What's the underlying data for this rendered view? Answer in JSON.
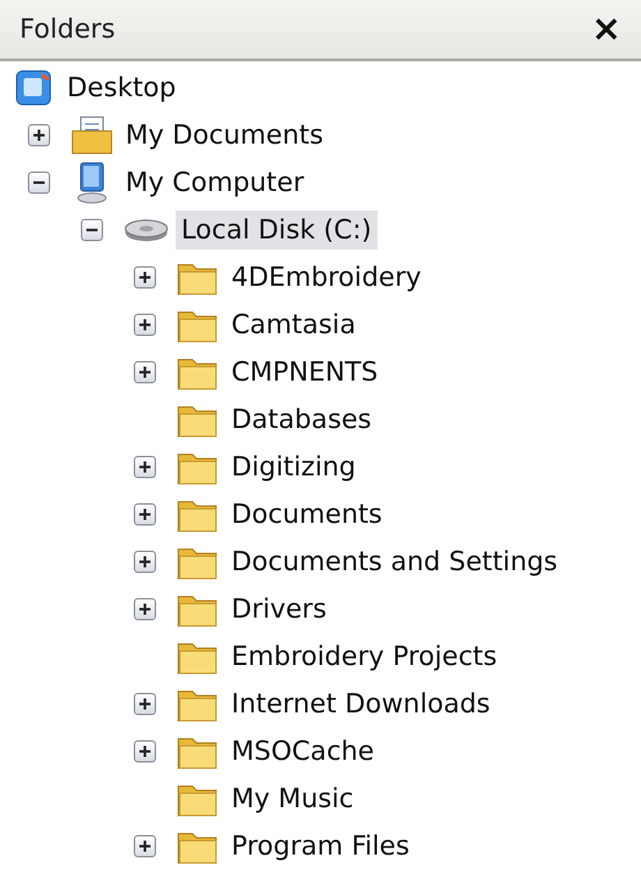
{
  "panel": {
    "title": "Folders",
    "close": "×"
  },
  "tree": [
    {
      "label": "Desktop",
      "kind": "desktop",
      "selected": false,
      "children": [
        {
          "label": "My Documents",
          "kind": "documents",
          "expanded": false,
          "selected": false
        },
        {
          "label": "My Computer",
          "kind": "computer",
          "expanded": true,
          "selected": false,
          "children": [
            {
              "label": "Local Disk (C:)",
              "kind": "drive",
              "expanded": true,
              "selected": true,
              "children": [
                {
                  "label": "4DEmbroidery",
                  "kind": "folder",
                  "expanded": false,
                  "selected": false
                },
                {
                  "label": "Camtasia",
                  "kind": "folder",
                  "expanded": false,
                  "selected": false
                },
                {
                  "label": "CMPNENTS",
                  "kind": "folder",
                  "expanded": false,
                  "selected": false
                },
                {
                  "label": "Databases",
                  "kind": "folder",
                  "selected": false
                },
                {
                  "label": "Digitizing",
                  "kind": "folder",
                  "expanded": false,
                  "selected": false
                },
                {
                  "label": "Documents",
                  "kind": "folder",
                  "expanded": false,
                  "selected": false
                },
                {
                  "label": "Documents and Settings",
                  "kind": "folder",
                  "expanded": false,
                  "selected": false
                },
                {
                  "label": "Drivers",
                  "kind": "folder",
                  "expanded": false,
                  "selected": false
                },
                {
                  "label": "Embroidery Projects",
                  "kind": "folder",
                  "selected": false
                },
                {
                  "label": "Internet Downloads",
                  "kind": "folder",
                  "expanded": false,
                  "selected": false
                },
                {
                  "label": "MSOCache",
                  "kind": "folder",
                  "expanded": false,
                  "selected": false
                },
                {
                  "label": "My Music",
                  "kind": "folder",
                  "selected": false
                },
                {
                  "label": "Program Files",
                  "kind": "folder",
                  "expanded": false,
                  "selected": false
                }
              ]
            }
          ]
        }
      ]
    }
  ]
}
